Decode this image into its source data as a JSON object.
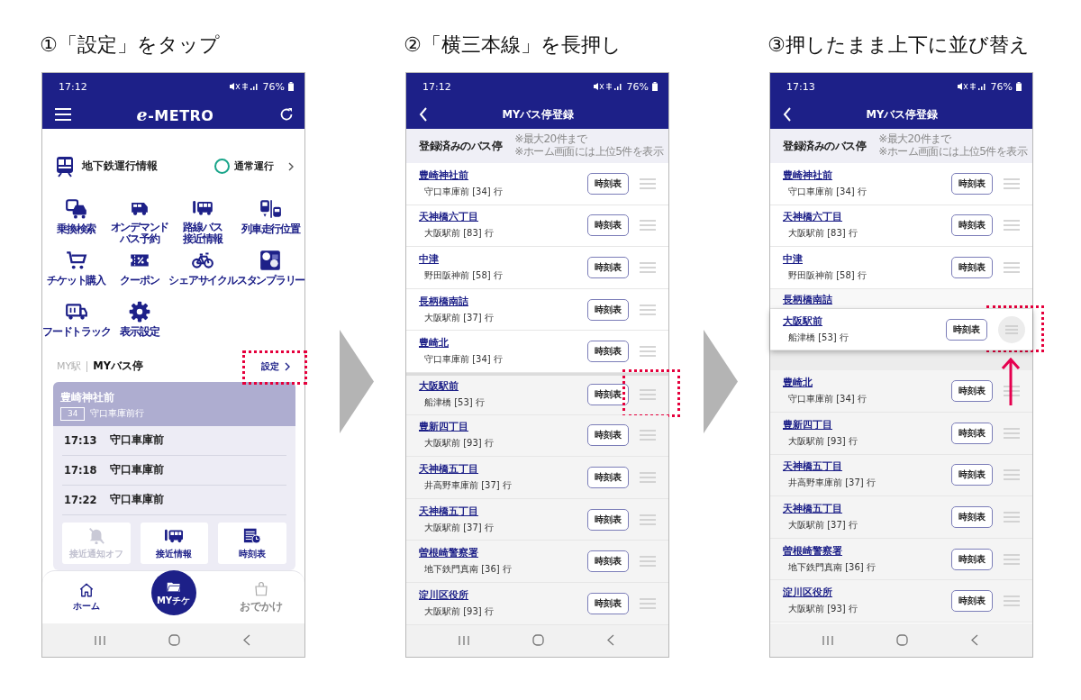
{
  "steps": [
    {
      "title": "①「設定」をタップ",
      "screen": {
        "kind": "home",
        "status_bar": {
          "time": "17:12",
          "battery": "76%"
        },
        "header": {
          "logo": "e-METRO"
        },
        "service": {
          "label": "地下鉄運行情報",
          "status": "通常運行"
        },
        "menu": [
          {
            "lines": [
              "乗換検索"
            ]
          },
          {
            "lines": [
              "オンデマンド",
              "バス予約"
            ]
          },
          {
            "lines": [
              "路線バス",
              "接近情報"
            ]
          },
          {
            "lines": [
              "列車走行位置"
            ]
          },
          {
            "lines": [
              "チケット購入"
            ]
          },
          {
            "lines": [
              "クーポン"
            ]
          },
          {
            "lines": [
              "シェアサイクル"
            ]
          },
          {
            "lines": [
              "スタンプラリー"
            ]
          },
          {
            "lines": [
              "フードトラック"
            ]
          },
          {
            "lines": [
              "表示設定"
            ]
          }
        ],
        "sections": [
          {
            "label": "MY駅",
            "selected": false
          },
          {
            "label": "MYバス停",
            "selected": true
          }
        ],
        "settings": {
          "label": "設定",
          "highlighted": true
        },
        "card": {
          "stop": "豊崎神社前",
          "route": "34",
          "destination": "守口車庫前行",
          "departures": [
            {
              "time": "17:13",
              "destination": "守口車庫前"
            },
            {
              "time": "17:18",
              "destination": "守口車庫前"
            },
            {
              "time": "17:22",
              "destination": "守口車庫前"
            }
          ],
          "actions": [
            {
              "label": "接近通知オフ",
              "disabled": true
            },
            {
              "label": "接近情報",
              "disabled": false
            },
            {
              "label": "時刻表",
              "disabled": false
            }
          ]
        },
        "bottom_nav": [
          {
            "label": "ホーム",
            "kind": "tab",
            "disabled": false
          },
          {
            "label": "MYチケ",
            "kind": "center",
            "disabled": false
          },
          {
            "label": "おでかけ",
            "kind": "tab",
            "disabled": true
          }
        ]
      }
    },
    {
      "title": "②「横三本線」を長押し",
      "screen": {
        "kind": "list",
        "status_bar": {
          "time": "17:12",
          "battery": "76%"
        },
        "header": {
          "title": "MYバス停登録"
        },
        "list_header": {
          "label": "登録済みのバス停",
          "notes": [
            "※最大20件まで",
            "※ホーム画面には上位5件を表示"
          ]
        },
        "rows": [
          {
            "kind": "row",
            "stop": "豊崎神社前",
            "destination": "守口車庫前 [34] 行",
            "button": "時刻表",
            "dimmed": false,
            "highlighted": false
          },
          {
            "kind": "row",
            "stop": "天神橋六丁目",
            "destination": "大阪駅前 [83] 行",
            "button": "時刻表",
            "dimmed": false,
            "highlighted": false
          },
          {
            "kind": "row",
            "stop": "中津",
            "destination": "野田阪神前 [58] 行",
            "button": "時刻表",
            "dimmed": false,
            "highlighted": false
          },
          {
            "kind": "row",
            "stop": "長柄橋南詰",
            "destination": "大阪駅前 [37] 行",
            "button": "時刻表",
            "dimmed": false,
            "highlighted": false
          },
          {
            "kind": "row",
            "stop": "豊崎北",
            "destination": "守口車庫前 [34] 行",
            "button": "時刻表",
            "dimmed": false,
            "highlighted": false
          },
          {
            "kind": "row",
            "stop": "大阪駅前",
            "destination": "船津橋 [53] 行",
            "button": "時刻表",
            "dimmed": true,
            "highlighted": true
          },
          {
            "kind": "row",
            "stop": "豊新四丁目",
            "destination": "大阪駅前 [93] 行",
            "button": "時刻表",
            "dimmed": true,
            "highlighted": false
          },
          {
            "kind": "row",
            "stop": "天神橋五丁目",
            "destination": "井高野車庫前 [37] 行",
            "button": "時刻表",
            "dimmed": true,
            "highlighted": false
          },
          {
            "kind": "row",
            "stop": "天神橋五丁目",
            "destination": "大阪駅前 [37] 行",
            "button": "時刻表",
            "dimmed": true,
            "highlighted": false
          },
          {
            "kind": "row",
            "stop": "曽根崎警察署",
            "destination": "地下鉄門真南 [36] 行",
            "button": "時刻表",
            "dimmed": true,
            "highlighted": false
          },
          {
            "kind": "row",
            "stop": "淀川区役所",
            "destination": "大阪駅前 [93] 行",
            "button": "時刻表",
            "dimmed": true,
            "highlighted": false
          }
        ]
      }
    },
    {
      "title": "③押したまま上下に並び替え",
      "screen": {
        "kind": "list",
        "status_bar": {
          "time": "17:13",
          "battery": "76%"
        },
        "header": {
          "title": "MYバス停登録"
        },
        "list_header": {
          "label": "登録済みのバス停",
          "notes": [
            "※最大20件まで",
            "※ホーム画面には上位5件を表示"
          ]
        },
        "rows": [
          {
            "kind": "row",
            "stop": "豊崎神社前",
            "destination": "守口車庫前 [34] 行",
            "button": "時刻表",
            "dimmed": false,
            "highlighted": false
          },
          {
            "kind": "row",
            "stop": "天神橋六丁目",
            "destination": "大阪駅前 [83] 行",
            "button": "時刻表",
            "dimmed": false,
            "highlighted": false
          },
          {
            "kind": "row",
            "stop": "中津",
            "destination": "野田阪神前 [58] 行",
            "button": "時刻表",
            "dimmed": false,
            "highlighted": false
          },
          {
            "kind": "covered",
            "stop": "長柄橋南詰"
          },
          {
            "kind": "dragged",
            "stop": "大阪駅前",
            "destination": "船津橋 [53] 行",
            "button": "時刻表",
            "dimmed": false,
            "highlighted": true
          },
          {
            "kind": "gap"
          },
          {
            "kind": "row",
            "stop": "豊崎北",
            "destination": "守口車庫前 [34] 行",
            "button": "時刻表",
            "dimmed": true,
            "highlighted": false
          },
          {
            "kind": "row",
            "stop": "豊新四丁目",
            "destination": "大阪駅前 [93] 行",
            "button": "時刻表",
            "dimmed": true,
            "highlighted": false
          },
          {
            "kind": "row",
            "stop": "天神橋五丁目",
            "destination": "井高野車庫前 [37] 行",
            "button": "時刻表",
            "dimmed": true,
            "highlighted": false
          },
          {
            "kind": "row",
            "stop": "天神橋五丁目",
            "destination": "大阪駅前 [37] 行",
            "button": "時刻表",
            "dimmed": true,
            "highlighted": false
          },
          {
            "kind": "row",
            "stop": "曽根崎警察署",
            "destination": "地下鉄門真南 [36] 行",
            "button": "時刻表",
            "dimmed": true,
            "highlighted": false
          },
          {
            "kind": "row",
            "stop": "淀川区役所",
            "destination": "大阪駅前 [93] 行",
            "button": "時刻表",
            "dimmed": true,
            "highlighted": false
          }
        ]
      }
    }
  ]
}
